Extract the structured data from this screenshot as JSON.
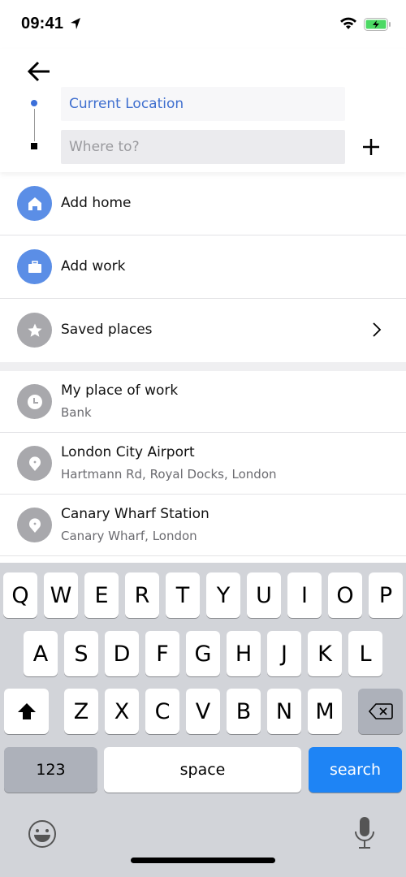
{
  "status_bar": {
    "time": "09:41",
    "icons": [
      "location-arrow-icon",
      "wifi-icon",
      "battery-charging-icon"
    ]
  },
  "header": {
    "back_icon": "arrow-left-icon",
    "from_value": "Current Location",
    "to_placeholder": "Where to?",
    "to_value": "",
    "add_stop_icon": "plus-icon"
  },
  "shortcuts": [
    {
      "title": "Add home",
      "icon": "home-icon",
      "color": "#5b8ee6"
    },
    {
      "title": "Add work",
      "icon": "briefcase-icon",
      "color": "#5b8ee6"
    },
    {
      "title": "Saved places",
      "icon": "star-icon",
      "color": "#a8a8ac",
      "chevron": "chevron-right-icon"
    }
  ],
  "recent": [
    {
      "title": "My place of work",
      "subtitle": "Bank",
      "icon": "clock-icon"
    },
    {
      "title": "London City Airport",
      "subtitle": "Hartmann Rd, Royal Docks, London",
      "icon": "pin-icon"
    },
    {
      "title": "Canary Wharf Station",
      "subtitle": "Canary Wharf, London",
      "icon": "pin-icon"
    }
  ],
  "keyboard": {
    "row1": [
      "Q",
      "W",
      "E",
      "R",
      "T",
      "Y",
      "U",
      "I",
      "O",
      "P"
    ],
    "row2": [
      "A",
      "S",
      "D",
      "F",
      "G",
      "H",
      "J",
      "K",
      "L"
    ],
    "row3": [
      "Z",
      "X",
      "C",
      "V",
      "B",
      "N",
      "M"
    ],
    "numbers_label": "123",
    "space_label": "space",
    "action_label": "search",
    "action_color": "#1e84f5"
  }
}
